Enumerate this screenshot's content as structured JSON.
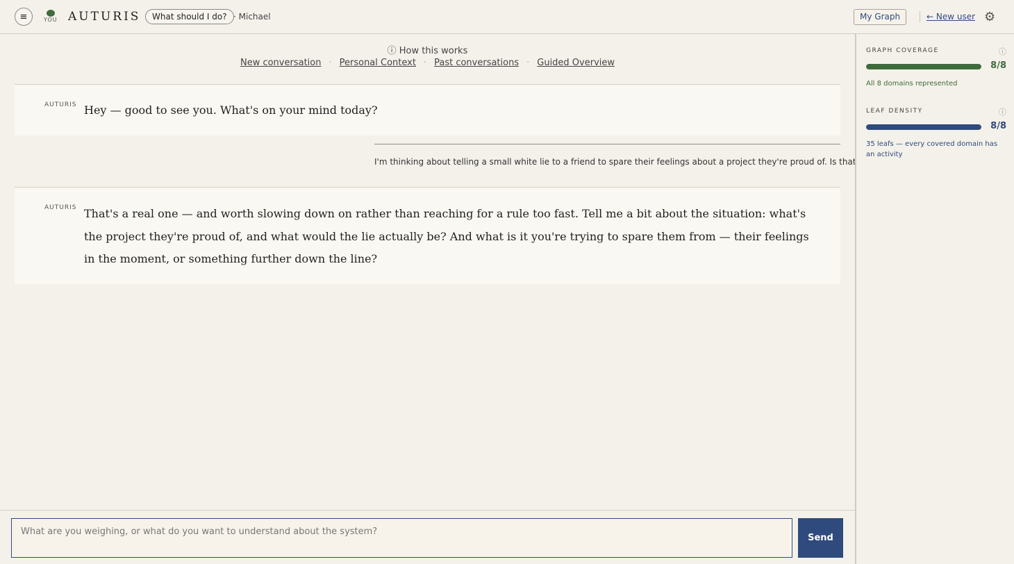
{
  "header": {
    "menu_icon": "menu-icon",
    "logo_caption": "YOU",
    "brand": "AUTURIS",
    "mode_label": "What should I do?",
    "user_label": "· Michael",
    "my_graph_label": "My Graph",
    "new_user_label": "← New user",
    "settings_icon": "gear-icon"
  },
  "chat_nav": {
    "how_it_works": "ⓘ How this works",
    "links": [
      "New conversation",
      "Personal Context",
      "Past conversations",
      "Guided Overview"
    ],
    "separator": "·"
  },
  "messages": [
    {
      "sender": "AUTURIS",
      "text": "Hey — good to see you. What's on your mind today?"
    },
    {
      "sender": "user",
      "text": "I'm thinking about telling a small white lie to a friend to spare their feelings about a project they're proud of. Is that okay?"
    },
    {
      "sender": "AUTURIS",
      "text": "That's a real one — and worth slowing down on rather than reaching for a rule too fast. Tell me a bit about the situation: what's the project they're proud of, and what would the lie actually be? And what is it you're trying to spare them from — their feelings in the moment, or something further down the line?"
    }
  ],
  "composer": {
    "placeholder": "What are you weighing, or what do you want to understand about the system?",
    "send_label": "Send"
  },
  "sidebar": {
    "metrics": [
      {
        "title": "GRAPH COVERAGE",
        "info_icon": "info-icon",
        "value": "8/8",
        "fraction": 1.0,
        "color": "#3f6b3c",
        "note": "All 8 domains represented"
      },
      {
        "title": "LEAF DENSITY",
        "info_icon": "info-icon",
        "value": "8/8",
        "fraction": 1.0,
        "color": "#2f4a7d",
        "note": "35 leafs — every covered domain has an activity"
      }
    ]
  }
}
